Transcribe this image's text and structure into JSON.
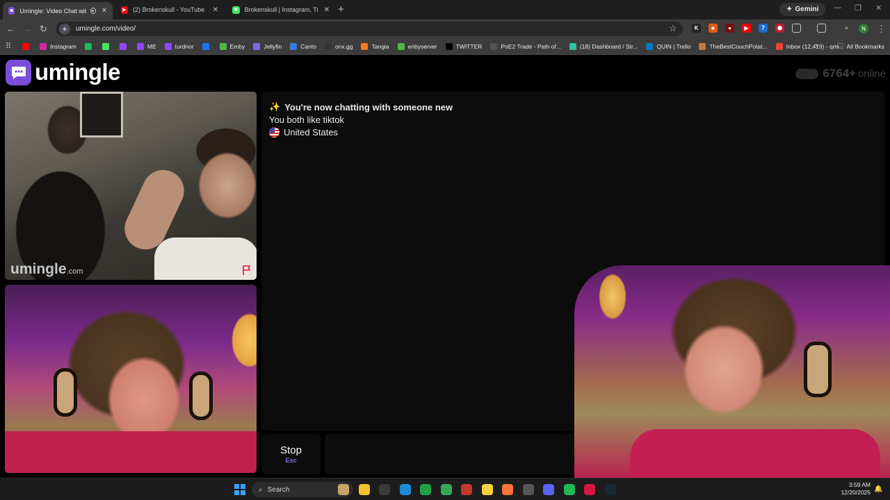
{
  "browser": {
    "tabs": [
      {
        "title": "Umingle: Video Chat with St",
        "icon": "umingle-icon",
        "color": "#7c4ddb",
        "active": true
      },
      {
        "title": "(2) Brokenskull - YouTube",
        "icon": "youtube-icon",
        "color": "#ff0000",
        "active": false
      },
      {
        "title": "Brokenskull | Instagram, TikTok,",
        "icon": "linktree-icon",
        "color": "#43e660",
        "active": false
      }
    ],
    "gemini_label": "Gemini",
    "url": "umingle.com/video/",
    "profile_initial": "N",
    "bookmarks": [
      {
        "label": "",
        "icon": "youtube-icon",
        "color": "#ff0000"
      },
      {
        "label": "Instagram",
        "icon": "instagram-icon",
        "color": "#d6249f"
      },
      {
        "label": "",
        "icon": "spotify-icon",
        "color": "#1db954"
      },
      {
        "label": "",
        "icon": "linktree-icon",
        "color": "#43e660"
      },
      {
        "label": "",
        "icon": "twitch-icon",
        "color": "#9146ff"
      },
      {
        "label": "ME",
        "icon": "twitch-icon",
        "color": "#9146ff"
      },
      {
        "label": "turdnor",
        "icon": "twitch-icon",
        "color": "#9146ff"
      },
      {
        "label": "",
        "icon": "facebook-icon",
        "color": "#1877f2"
      },
      {
        "label": "Emby",
        "icon": "emby-icon",
        "color": "#52b54b"
      },
      {
        "label": "Jellyfin",
        "icon": "jellyfin-icon",
        "color": "#7b68ee"
      },
      {
        "label": "Canto",
        "icon": "canto-icon",
        "color": "#3a7bd5"
      },
      {
        "label": "onx.gg",
        "icon": "onx-icon",
        "color": "#333333"
      },
      {
        "label": "Tangia",
        "icon": "tangia-icon",
        "color": "#f47a20"
      },
      {
        "label": "enbyserver",
        "icon": "emby-icon",
        "color": "#52b54b"
      },
      {
        "label": "TWITTER",
        "icon": "x-icon",
        "color": "#000000"
      },
      {
        "label": "PoE2 Trade - Path of...",
        "icon": "poe-icon",
        "color": "#555555"
      },
      {
        "label": "(18) Dashboard / Str...",
        "icon": "streamlabs-icon",
        "color": "#31c3a2"
      },
      {
        "label": "QUIN | Trello",
        "icon": "trello-icon",
        "color": "#0079bf"
      },
      {
        "label": "TheBestCouchPotat...",
        "icon": "couch-icon",
        "color": "#c0783c"
      },
      {
        "label": "Inbox (12,419) - qmi...",
        "icon": "gmail-icon",
        "color": "#ea4335"
      }
    ],
    "all_bookmarks_label": "All Bookmarks"
  },
  "site": {
    "logo_text": "umingle",
    "online_count": "6764+",
    "online_label": "online",
    "watermark_main": "umingle",
    "watermark_suffix": ".com",
    "accent_color": "#7c4ddb"
  },
  "chat": {
    "messages": [
      {
        "emoji": "✨",
        "text": "You're now chatting with someone new",
        "bold": true
      },
      {
        "text": "You both like tiktok",
        "bold": false
      },
      {
        "flag": "us",
        "text": "United States",
        "bold": false
      }
    ]
  },
  "controls": {
    "stop_label": "Stop",
    "stop_key": "Esc"
  },
  "taskbar": {
    "search_label": "Search",
    "time": "3:59 AM",
    "date": "12/20/2025",
    "apps": [
      {
        "name": "widgets-icon",
        "color": "#c9a36a"
      },
      {
        "name": "file-explorer-icon",
        "color": "#f2c230"
      },
      {
        "name": "obs-icon",
        "color": "#3a3a3a"
      },
      {
        "name": "edge-icon",
        "color": "#1f8ad8"
      },
      {
        "name": "media-player-icon",
        "color": "#24a148"
      },
      {
        "name": "chrome-icon",
        "color": "#34a853"
      },
      {
        "name": "game-icon",
        "color": "#c0392b"
      },
      {
        "name": "sticky-notes-icon",
        "color": "#f6d23f"
      },
      {
        "name": "firefox-icon",
        "color": "#ff7139"
      },
      {
        "name": "app-icon",
        "color": "#555555"
      },
      {
        "name": "discord-icon",
        "color": "#5865f2"
      },
      {
        "name": "spotify-icon",
        "color": "#1db954"
      },
      {
        "name": "app-red-icon",
        "color": "#d6163e"
      },
      {
        "name": "steam-icon",
        "color": "#1b2838"
      }
    ]
  }
}
